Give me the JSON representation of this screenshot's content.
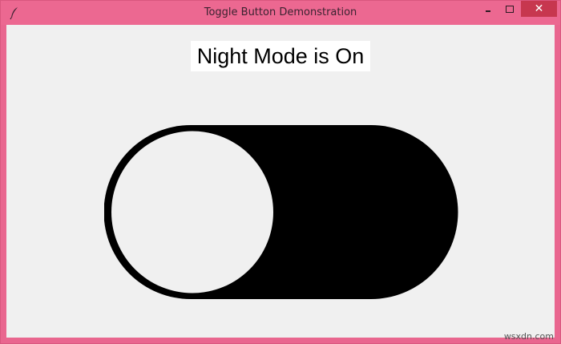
{
  "window": {
    "title": "Toggle Button Demonstration",
    "close_glyph": "✕"
  },
  "main": {
    "mode_label": "Night Mode is On",
    "toggle": {
      "state": "on",
      "track_color": "#000000",
      "knob_color": "#f0f0f0"
    }
  },
  "watermark": "wsxdn.com",
  "colors": {
    "titlebar": "#ec6891",
    "close_button": "#c7374f",
    "client_background": "#f0f0f0"
  },
  "icons": {
    "app": "feather-icon",
    "minimize": "minimize-icon",
    "maximize": "maximize-icon",
    "close": "close-icon"
  }
}
